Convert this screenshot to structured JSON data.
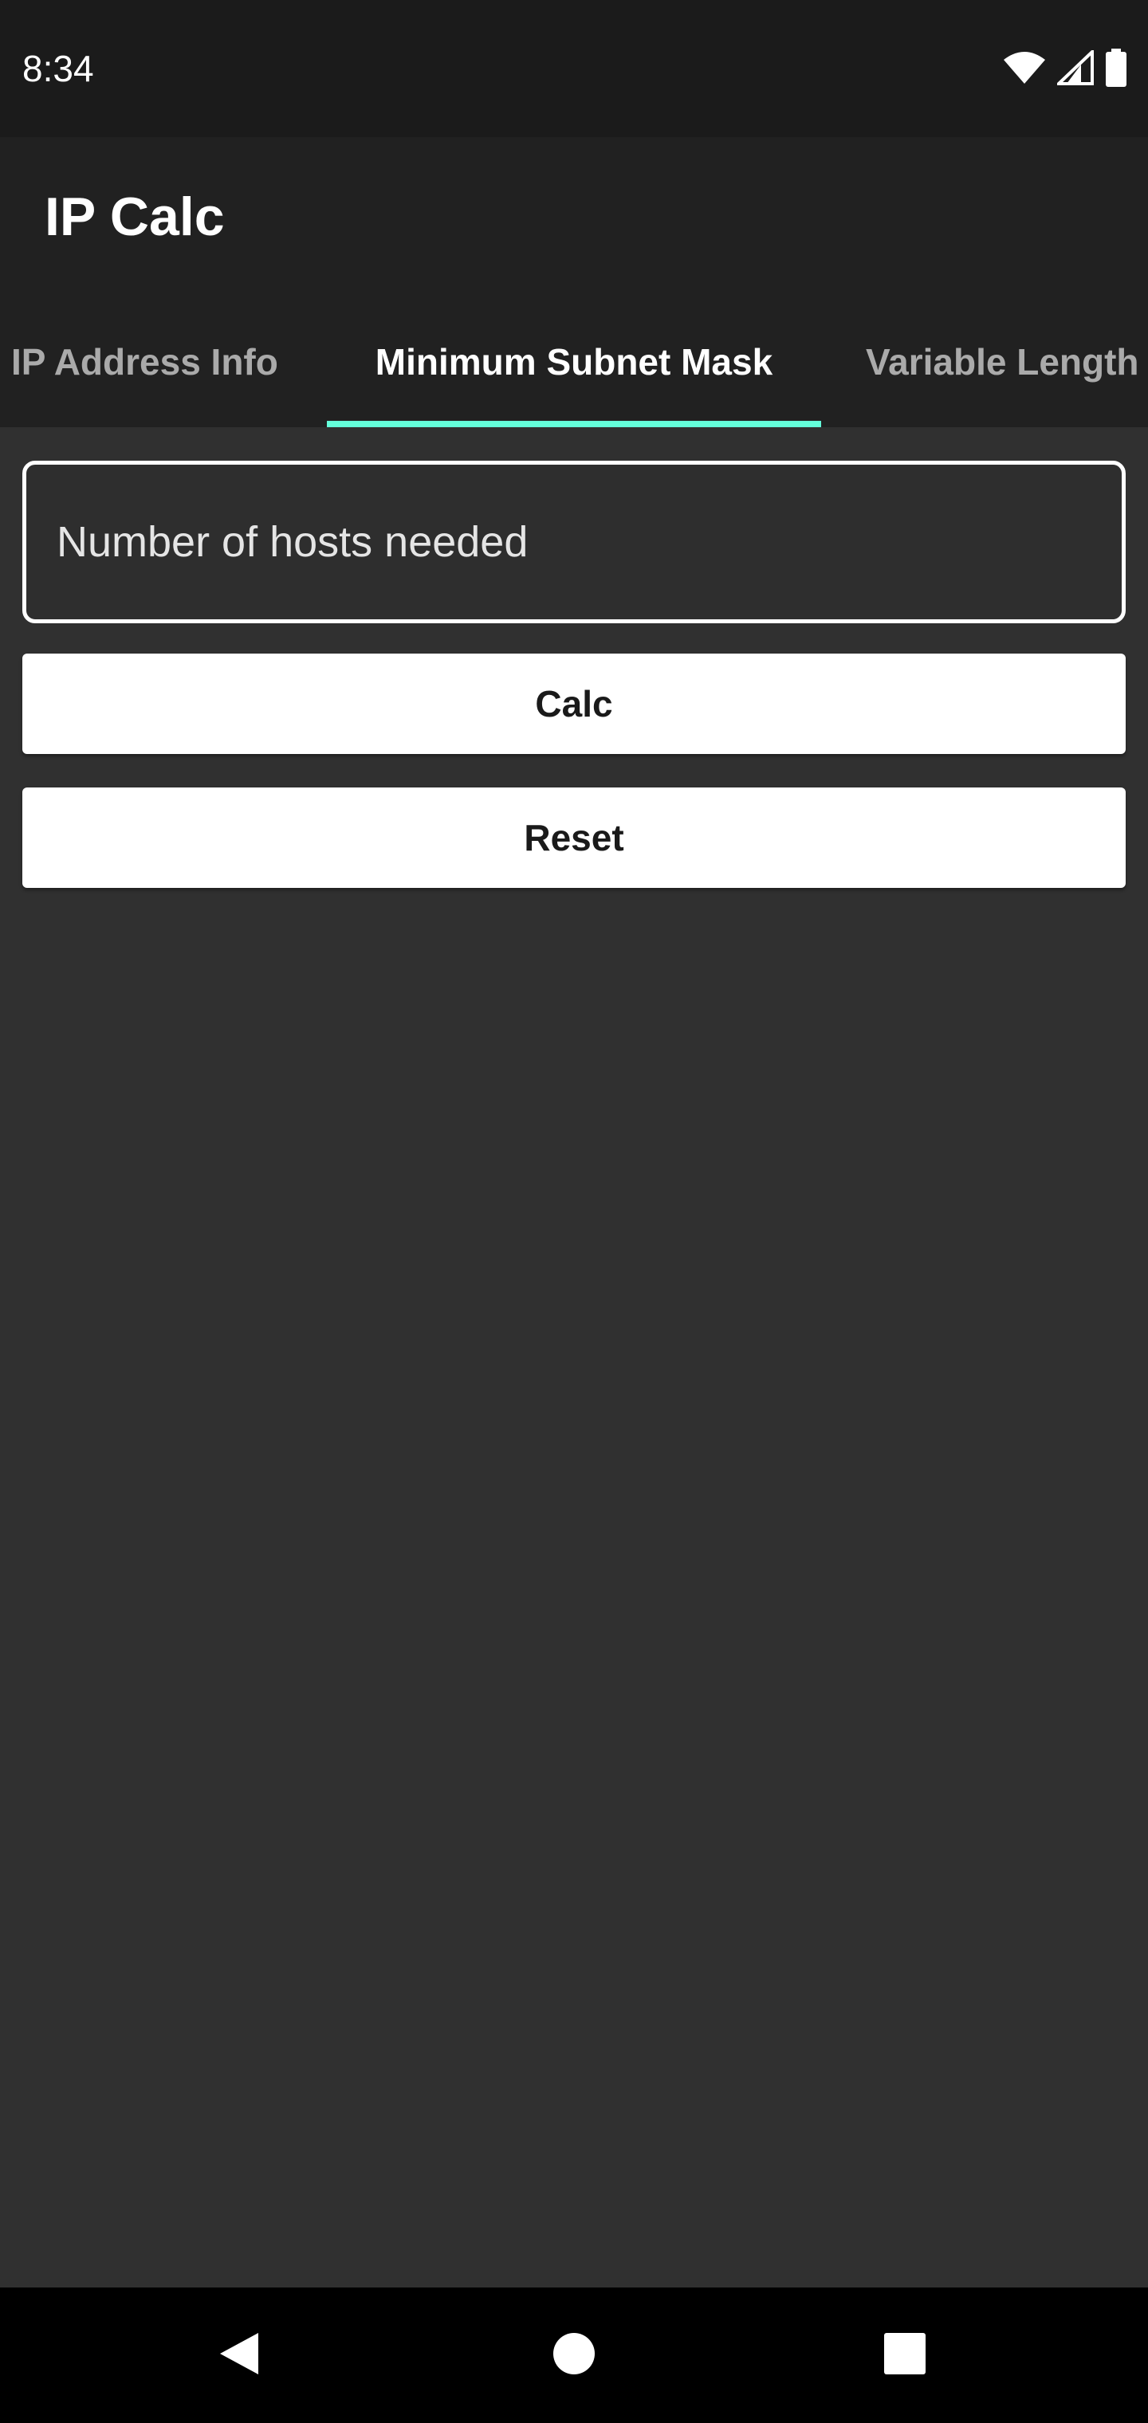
{
  "status_bar": {
    "time": "8:34",
    "icons": [
      "wifi-icon",
      "cell-signal-icon",
      "battery-icon"
    ]
  },
  "app_bar": {
    "title": "IP Calc"
  },
  "tabs": [
    {
      "label": "IP Address Info",
      "active": false
    },
    {
      "label": "Minimum Subnet Mask",
      "active": true
    },
    {
      "label": "Variable Length",
      "active": false
    }
  ],
  "hosts_input": {
    "placeholder": "Number of hosts needed",
    "value": ""
  },
  "buttons": {
    "calc_label": "Calc",
    "reset_label": "Reset"
  },
  "nav_bar": {
    "icons": [
      "back-icon",
      "home-icon",
      "recents-icon"
    ]
  },
  "colors": {
    "background": "#303030",
    "app_bar": "#212121",
    "status_bar": "#1b1b1b",
    "accent": "#64ffda",
    "button": "#ffffff",
    "nav_bar": "#000000"
  }
}
